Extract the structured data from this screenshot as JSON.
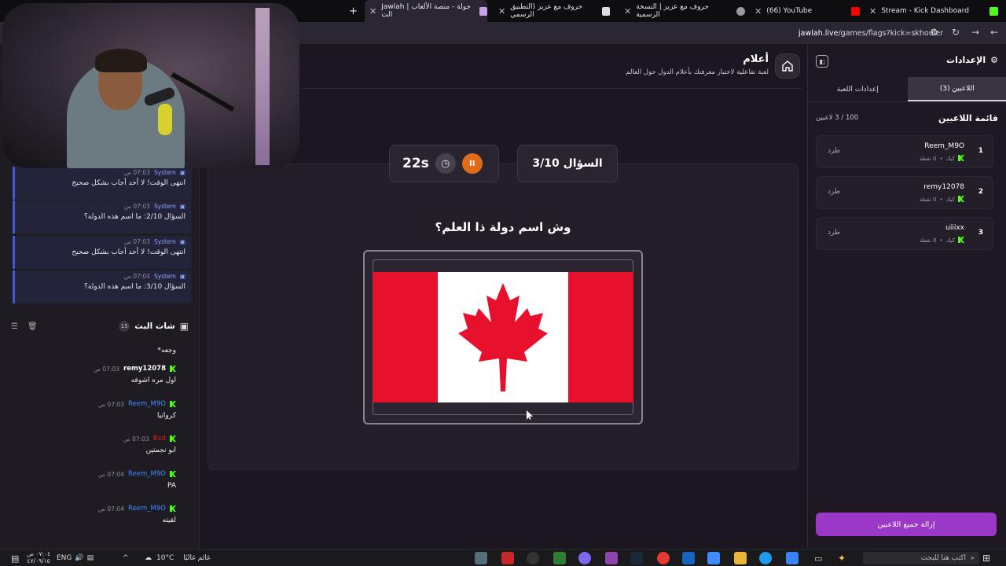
{
  "browser": {
    "tabs": [
      {
        "label": "Stream - Kick Dashboard",
        "active": false
      },
      {
        "label": "(66) YouTube",
        "active": false
      },
      {
        "label": "حروف مع عزيز | النسخة الرسمية",
        "active": false
      },
      {
        "label": "حروف مع عزيز (التطبيق الرسمي",
        "active": false
      },
      {
        "label": "Jawlah | جولة - منصة الألعاب الت",
        "active": true
      }
    ],
    "url_host": "jawlah.live",
    "url_path": "/games/flags?kick=skhouler"
  },
  "game": {
    "title": "أعلام",
    "subtitle": "لعبة تفاعلية لاختبار معرفتك بأعلام الدول حول العالم",
    "question_counter": "السؤال 3/10",
    "timer": "22s",
    "question": "وش اسم دولة ذا العلم؟",
    "flag_colors": {
      "red": "#e8112d",
      "white": "#ffffff"
    }
  },
  "system_messages": [
    {
      "sender": "System",
      "time": "07:03 ص",
      "text": "انتهى الوقت! لا أحد أجاب بشكل صحيح"
    },
    {
      "sender": "System",
      "time": "07:03 ص",
      "text": "السؤال 2/10: ما اسم هذه الدولة؟"
    },
    {
      "sender": "System",
      "time": "07:03 ص",
      "text": "انتهى الوقت! لا أحد أجاب بشكل صحيح"
    },
    {
      "sender": "System",
      "time": "07:04 ص",
      "text": "السؤال 3/10: ما اسم هذه الدولة؟"
    }
  ],
  "stream_chat": {
    "title": "شات البث",
    "count": "15",
    "partial_top": "وجعه*",
    "messages": [
      {
        "user": "remy12078",
        "time": "07:03 ص",
        "text": "اول مره اشوفه",
        "color": "#ffffff"
      },
      {
        "user": "Reem_M9O",
        "time": "07:03 ص",
        "text": "كرواتيا",
        "color": "#3f8cff"
      },
      {
        "user": "Bxd",
        "time": "07:03 ص",
        "text": "ابو نجمتين",
        "color": "#d22"
      },
      {
        "user": "Reem_M9O",
        "time": "07:04 ص",
        "text": "PA",
        "color": "#3f8cff"
      },
      {
        "user": "Reem_M9O",
        "time": "07:04 ص",
        "text": "لقيته",
        "color": "#3f8cff"
      }
    ]
  },
  "settings": {
    "title": "الإعدادات",
    "tabs": [
      {
        "label": "اللاعبين (3)",
        "active": true
      },
      {
        "label": "إعدادات اللعبة",
        "active": false
      }
    ],
    "list_title": "قائمة اللاعبين",
    "player_count": "100 / 3 لاعبين",
    "players": [
      {
        "rank": "1",
        "name": "Reem_M9O",
        "platform": "كيك",
        "points": "0 نقطة",
        "kick_label": "طرد"
      },
      {
        "rank": "2",
        "name": "remy12078",
        "platform": "كيك",
        "points": "0 نقطة",
        "kick_label": "طرد"
      },
      {
        "rank": "3",
        "name": "uiiixx",
        "platform": "كيك",
        "points": "0 نقطة",
        "kick_label": "طرد"
      }
    ],
    "remove_all": "إزالة جميع اللاعبين"
  },
  "taskbar": {
    "search_placeholder": "اكتب هنا للبحث",
    "weather": "10°C",
    "weather_text": "غائم غالبًا",
    "lang": "ENG",
    "time": "٠٧:٠٤ ص",
    "date": "٤٧/٠٩/١٥"
  }
}
